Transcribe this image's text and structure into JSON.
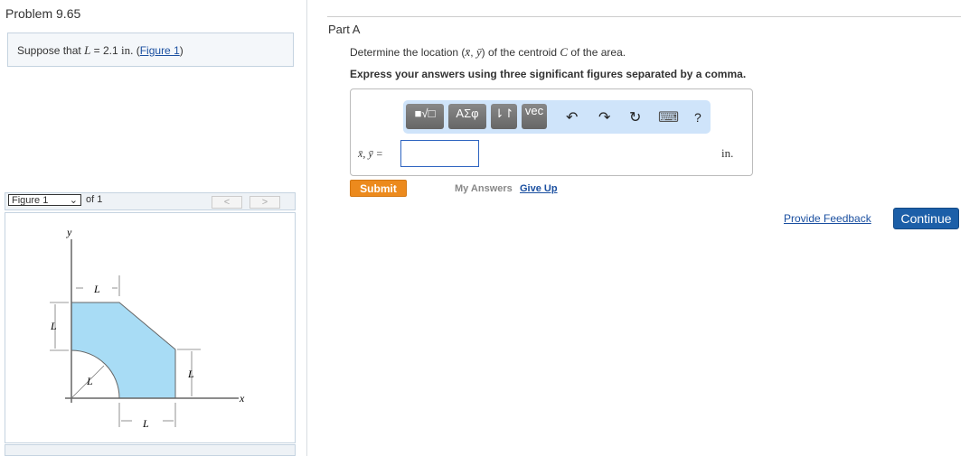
{
  "header": {
    "title": "Problem 9.65"
  },
  "problem": {
    "prefix": "Suppose that ",
    "var": "L",
    "eq": " = 2.1 ",
    "unit": "in.",
    "link_open": " (",
    "link": "Figure 1",
    "link_close": ")"
  },
  "figure": {
    "select": "Figure 1",
    "of": "of 1",
    "prev": "<",
    "next": ">",
    "labels": {
      "y": "y",
      "x": "x",
      "L": "L"
    }
  },
  "part": {
    "title": "Part A",
    "question_pre": "Determine the location (",
    "xbar": "x̄",
    "comma": ", ",
    "ybar": "ȳ",
    "question_mid": ") of the centroid ",
    "C": "C",
    "question_post": " of the area.",
    "instruction": "Express your answers using three significant figures separated by a comma."
  },
  "toolbar": {
    "templates": "■√□",
    "greek": "ΑΣφ",
    "arrows": "⇂↾",
    "vec": "vec",
    "undo": "↶",
    "redo": "↷",
    "reset": "↻",
    "keyboard": "⌨",
    "help": "?"
  },
  "answer": {
    "label": "x̄, ȳ =",
    "value": "",
    "unit": "in."
  },
  "actions": {
    "submit": "Submit",
    "my_answers": "My Answers",
    "give_up": "Give Up",
    "feedback": "Provide Feedback",
    "continue": "Continue"
  }
}
